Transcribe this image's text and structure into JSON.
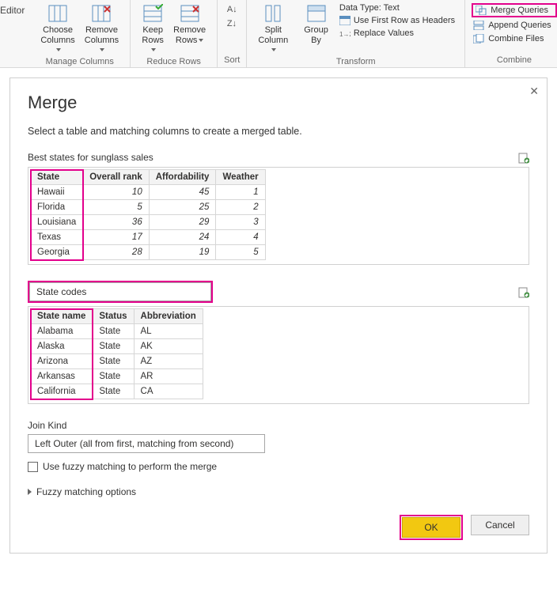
{
  "ribbon": {
    "editor_label": "Editor",
    "choose_cols": "Choose\nColumns",
    "remove_cols": "Remove\nColumns",
    "manage_cols": "Manage Columns",
    "keep_rows": "Keep\nRows",
    "remove_rows": "Remove\nRows",
    "reduce_rows": "Reduce Rows",
    "sort": "Sort",
    "split_col": "Split\nColumn",
    "group_by": "Group\nBy",
    "data_type_label": "Data Type: Text",
    "first_row_headers": "Use First Row as Headers",
    "replace_values": "Replace Values",
    "transform": "Transform",
    "merge_queries": "Merge Queries",
    "append_queries": "Append Queries",
    "combine_files": "Combine Files",
    "combine": "Combine"
  },
  "dialog": {
    "title": "Merge",
    "subtitle": "Select a table and matching columns to create a merged table.",
    "table1_caption": "Best states for sunglass sales",
    "table1": {
      "headers": [
        "State",
        "Overall rank",
        "Affordability",
        "Weather"
      ],
      "rows": [
        [
          "Hawaii",
          "10",
          "45",
          "1"
        ],
        [
          "Florida",
          "5",
          "25",
          "2"
        ],
        [
          "Louisiana",
          "36",
          "29",
          "3"
        ],
        [
          "Texas",
          "17",
          "24",
          "4"
        ],
        [
          "Georgia",
          "28",
          "19",
          "5"
        ]
      ]
    },
    "second_select": "State codes",
    "table2": {
      "headers": [
        "State name",
        "Status",
        "Abbreviation"
      ],
      "rows": [
        [
          "Alabama",
          "State",
          "AL"
        ],
        [
          "Alaska",
          "State",
          "AK"
        ],
        [
          "Arizona",
          "State",
          "AZ"
        ],
        [
          "Arkansas",
          "State",
          "AR"
        ],
        [
          "California",
          "State",
          "CA"
        ]
      ]
    },
    "join_kind_label": "Join Kind",
    "join_kind_value": "Left Outer (all from first, matching from second)",
    "fuzzy_check": "Use fuzzy matching to perform the merge",
    "fuzzy_opts": "Fuzzy matching options",
    "ok": "OK",
    "cancel": "Cancel"
  }
}
